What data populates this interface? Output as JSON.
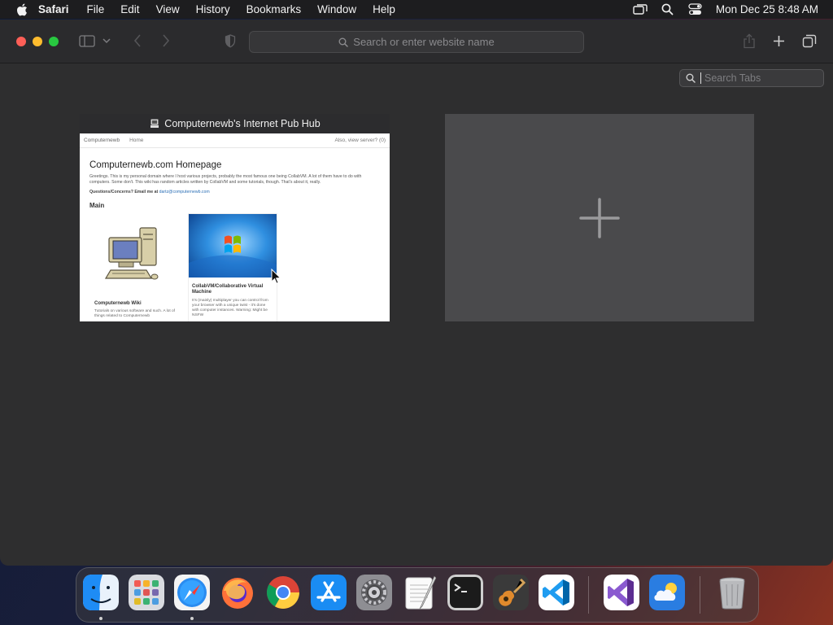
{
  "menubar": {
    "app_name": "Safari",
    "items": [
      "File",
      "Edit",
      "View",
      "History",
      "Bookmarks",
      "Window",
      "Help"
    ],
    "clock": "Mon Dec 25  8:48 AM"
  },
  "toolbar": {
    "address_placeholder": "Search or enter website name"
  },
  "tab_overview": {
    "search_placeholder": "Search Tabs",
    "tab": {
      "title": "Computernewb's Internet Pub Hub",
      "site": {
        "brand": "Computernewb",
        "nav_link": "Home",
        "nav_right": "Also, view server? (0)",
        "heading": "Computernewb.com Homepage",
        "intro": "Greetings. This is my personal domain where I host various projects, probably the most famous one being CollabVM. A lot of them have to do with computers. Some don't. This wiki has random articles written by CollabVM and some tutorials, though. That's about it, really.",
        "contact_label": "Questions/Concerns? Email me at",
        "contact_email": "dartz@computernewb.com",
        "section": "Main",
        "card1_title": "Computernewb Wiki",
        "card1_desc": "Tutorials on various software and such. A lot of things related to Computernewb",
        "card2_title": "CollabVM/Collaborative Virtual Machine",
        "card2_desc": "It's (mainly) multiplayer you can control from your browser with a unique twist - it's done with computer instances. Warning: Might be NSFW"
      }
    }
  },
  "dock": {
    "apps": [
      "Finder",
      "Launchpad",
      "Safari",
      "Firefox",
      "Google Chrome",
      "App Store",
      "System Preferences",
      "TextEdit",
      "Terminal",
      "GarageBand",
      "Visual Studio Code",
      "Visual Studio",
      "Weather",
      "Trash"
    ]
  },
  "colors": {
    "close": "#fe5f57",
    "minimize": "#febc2e",
    "maximize": "#28c840",
    "link": "#2b6fb6"
  }
}
